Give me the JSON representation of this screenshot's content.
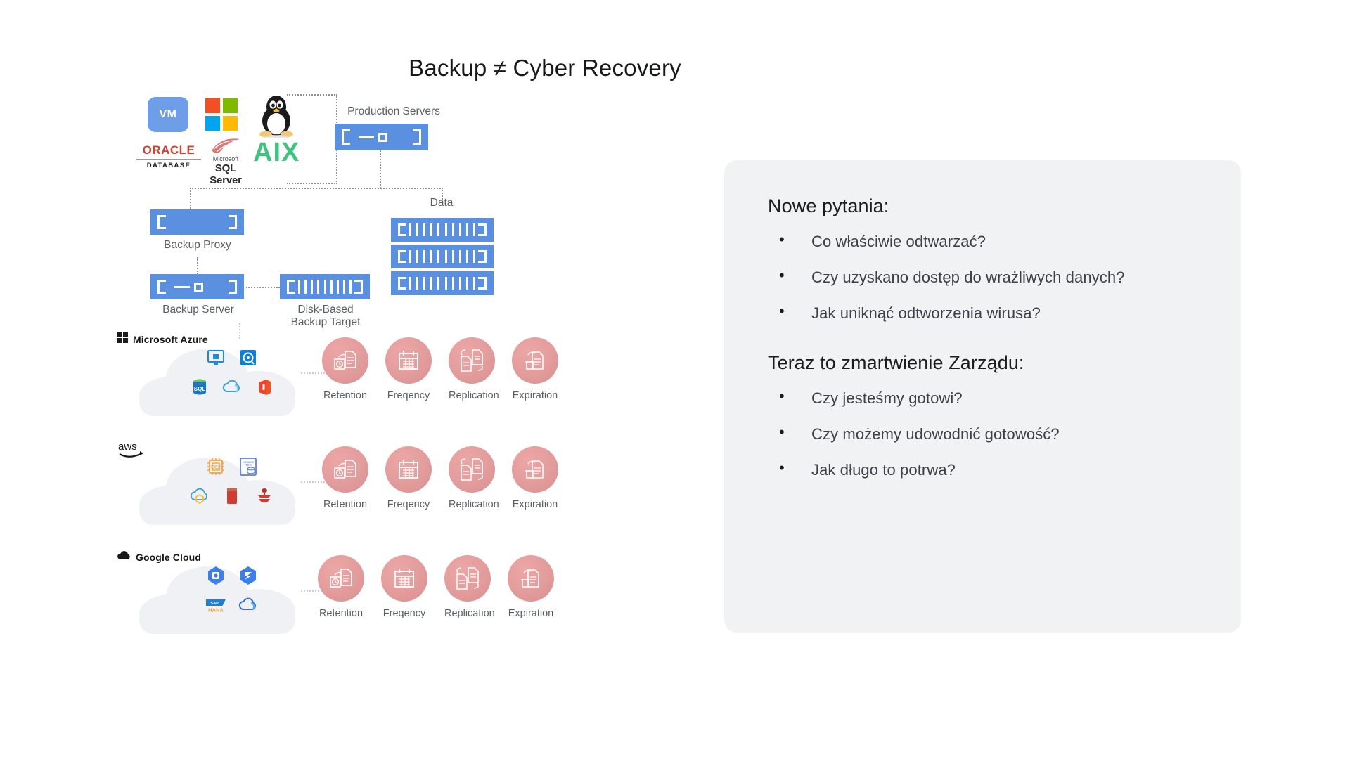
{
  "slide": {
    "title": "Backup ≠ Cyber Recovery",
    "background": "#ffffff"
  },
  "diagram": {
    "os_logos": [
      {
        "name": "vmware",
        "label": "VM"
      },
      {
        "name": "microsoft-windows",
        "label": ""
      },
      {
        "name": "linux-tux",
        "label": ""
      },
      {
        "name": "oracle-database",
        "label": "ORACLE",
        "sublabel": "DATABASE"
      },
      {
        "name": "microsoft-sql-server",
        "label": "Microsoft",
        "sublabel": "SQL Server"
      },
      {
        "name": "ibm-aix",
        "label": "AIX"
      }
    ],
    "nodes": [
      {
        "id": "production-servers",
        "label": "Production Servers",
        "color": "#5b8fe0"
      },
      {
        "id": "backup-proxy",
        "label": "Backup Proxy",
        "color": "#5b8fe0"
      },
      {
        "id": "backup-server",
        "label": "Backup Server",
        "color": "#5b8fe0"
      },
      {
        "id": "disk-based-backup-target",
        "label": "Disk-Based\nBackup Target",
        "label_line1": "Disk-Based",
        "label_line2": "Backup Target",
        "color": "#5b8fe0"
      },
      {
        "id": "data",
        "label": "Data",
        "color": "#5b8fe0"
      }
    ],
    "clouds": [
      {
        "vendor": "Microsoft Azure",
        "vendor_icon": "microsoft-azure-logo",
        "services": [
          [
            "azure-virtual-machine-icon",
            "azure-managed-disk-icon"
          ],
          [
            "azure-sql-database-icon",
            "azure-cloud-icon",
            "microsoft-office-365-icon"
          ]
        ],
        "policies": [
          "Retention",
          "Freqency",
          "Replication",
          "Expiration"
        ]
      },
      {
        "vendor": "aws",
        "vendor_icon": "aws-logo",
        "services": [
          [
            "aws-ec2-icon",
            "amazon-rds-icon"
          ],
          [
            "aws-cloud-icon",
            "amazon-redshift-icon",
            "amazon-dynamodb-icon"
          ]
        ],
        "policies": [
          "Retention",
          "Freqency",
          "Replication",
          "Expiration"
        ]
      },
      {
        "vendor": "Google Cloud",
        "vendor_icon": "google-cloud-logo",
        "services": [
          [
            "gcp-compute-engine-icon",
            "gcp-storage-icon"
          ],
          [
            "sap-hana-icon",
            "gcp-cloud-icon"
          ]
        ],
        "policies": [
          "Retention",
          "Freqency",
          "Replication",
          "Expiration"
        ]
      }
    ],
    "policy_icons": [
      "retention-clock-document-icon",
      "calendar-icon",
      "replication-documents-icon",
      "expiration-trash-document-icon"
    ],
    "colors": {
      "node_blue": "#5b8fe0",
      "policy_pink": "#e29c9c",
      "cloud_gray": "#f0f1f4",
      "connector": "#8d8f93"
    }
  },
  "panel": {
    "background": "#f1f2f4",
    "section1": {
      "heading": "Nowe pytania:",
      "items": [
        "Co właściwie odtwarzać?",
        "Czy uzyskano dostęp do wrażliwych danych?",
        "Jak uniknąć odtworzenia wirusa?"
      ]
    },
    "section2": {
      "heading": "Teraz to zmartwienie Zarządu:",
      "items": [
        "Czy jesteśmy gotowi?",
        "Czy możemy udowodnić gotowość?",
        "Jak długo to potrwa?"
      ]
    }
  }
}
